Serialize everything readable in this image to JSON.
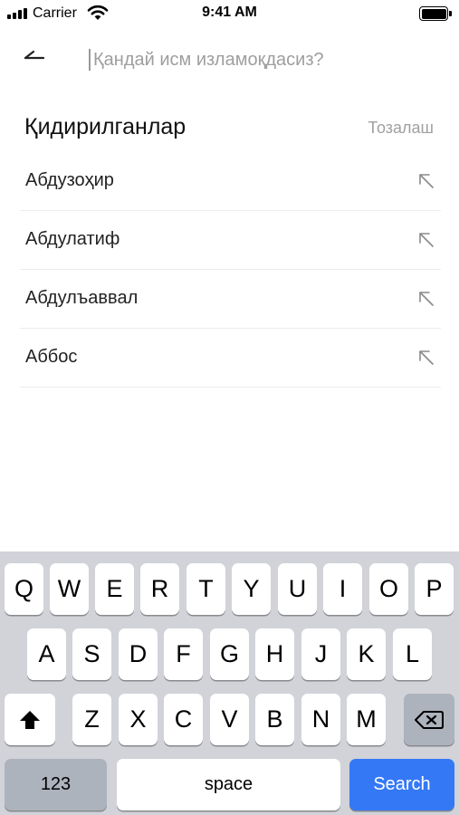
{
  "status_bar": {
    "carrier": "Carrier",
    "time": "9:41 AM"
  },
  "search": {
    "placeholder": "Қандай исм изламоқдасиз?",
    "value": ""
  },
  "recent": {
    "title": "Қидирилганлар",
    "clear_label": "Тозалаш",
    "items": [
      {
        "label": "Абдузоҳир"
      },
      {
        "label": "Абдулатиф"
      },
      {
        "label": "Абдулъаввал"
      },
      {
        "label": "Аббос"
      }
    ]
  },
  "keyboard": {
    "row1": [
      "Q",
      "W",
      "E",
      "R",
      "T",
      "Y",
      "U",
      "I",
      "O",
      "P"
    ],
    "row2": [
      "A",
      "S",
      "D",
      "F",
      "G",
      "H",
      "J",
      "K",
      "L"
    ],
    "row3": [
      "Z",
      "X",
      "C",
      "V",
      "B",
      "N",
      "M"
    ],
    "numbers_label": "123",
    "space_label": "space",
    "search_label": "Search"
  },
  "colors": {
    "accent": "#3478f6",
    "keyboard_bg": "#d1d3d9",
    "placeholder": "#9e9e9e"
  }
}
